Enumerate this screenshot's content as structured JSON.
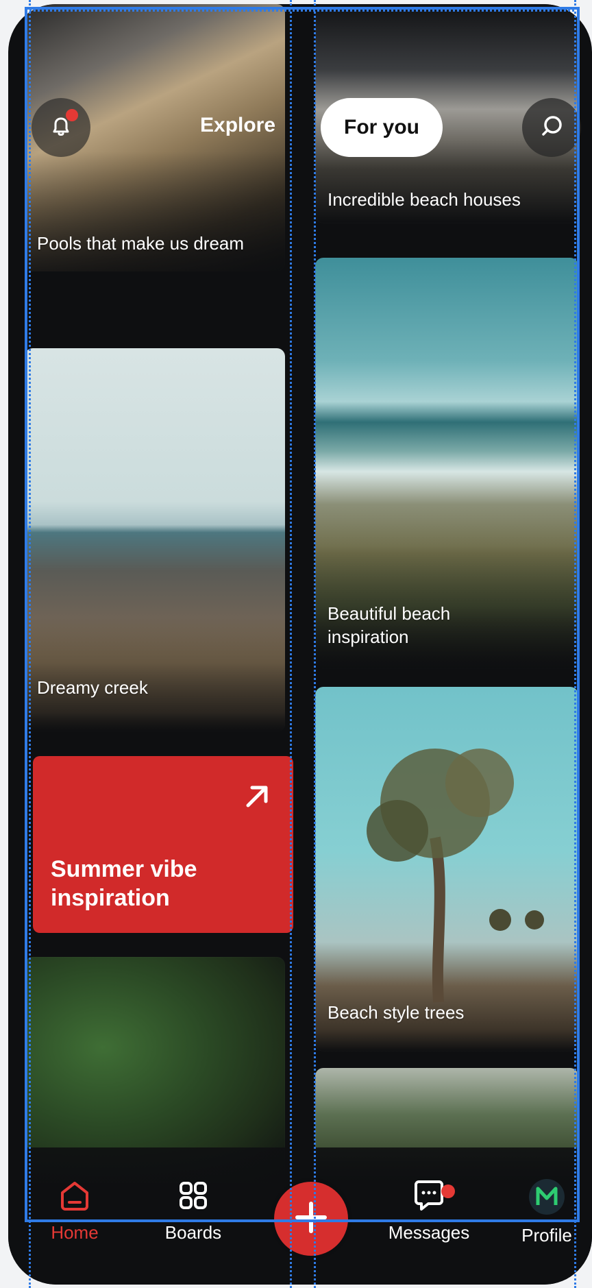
{
  "header": {
    "explore_label": "Explore",
    "for_you_label": "For you"
  },
  "cards": {
    "pools": {
      "label": "Pools that make us dream"
    },
    "beach_houses": {
      "label": "Incredible beach houses"
    },
    "dreamy_creek": {
      "label": "Dreamy creek"
    },
    "beach_inspiration": {
      "label": "Beautiful beach inspiration"
    },
    "beach_trees": {
      "label": "Beach style trees"
    }
  },
  "promo": {
    "title": "Summer vibe inspiration"
  },
  "nav": {
    "home": "Home",
    "boards": "Boards",
    "messages": "Messages",
    "profile": "Profile"
  },
  "colors": {
    "accent": "#d62e2e",
    "background": "#0e0f11",
    "guides": "#2f7be6"
  },
  "icons": {
    "notifications": "bell-icon",
    "search": "search-icon",
    "promo": "arrow-up-right-icon",
    "home": "home-icon",
    "boards": "grid-icon",
    "create": "plus-icon",
    "messages": "chat-bubble-icon",
    "profile": "avatar-m-icon"
  }
}
